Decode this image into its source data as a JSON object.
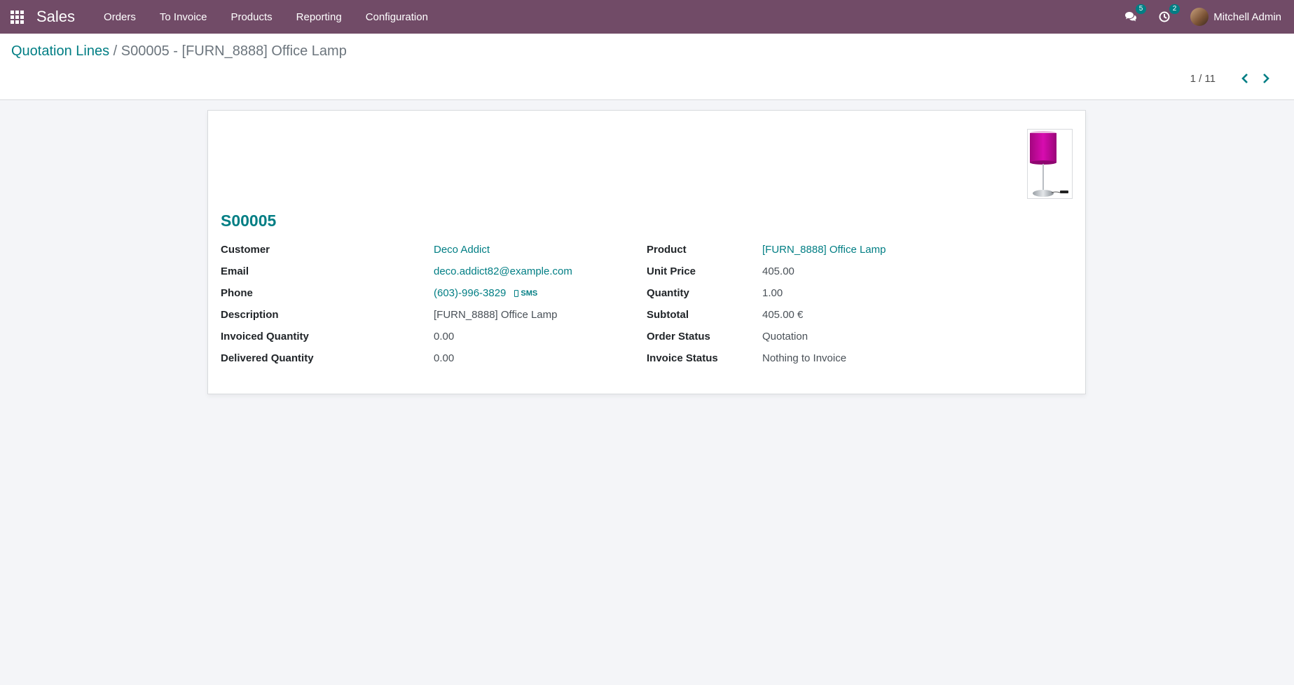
{
  "navbar": {
    "app_name": "Sales",
    "menu": [
      "Orders",
      "To Invoice",
      "Products",
      "Reporting",
      "Configuration"
    ],
    "messages_count": "5",
    "activities_count": "2",
    "user_name": "Mitchell Admin",
    "color": "#714b67"
  },
  "breadcrumb": {
    "parent": "Quotation Lines",
    "separator": "/",
    "current": "S00005 - [FURN_8888] Office Lamp"
  },
  "pager": {
    "value": "1 / 11"
  },
  "form": {
    "title": "S00005",
    "left": [
      {
        "label": "Customer",
        "value": "Deco Addict"
      },
      {
        "label": "Email",
        "value": "deco.addict82@example.com"
      },
      {
        "label": "Phone",
        "value": "(603)-996-3829",
        "sms_label": "SMS"
      },
      {
        "label": "Description",
        "value": "[FURN_8888] Office Lamp"
      },
      {
        "label": "Invoiced Quantity",
        "value": "0.00"
      },
      {
        "label": "Delivered Quantity",
        "value": "0.00"
      }
    ],
    "right": [
      {
        "label": "Product",
        "value": "[FURN_8888] Office Lamp"
      },
      {
        "label": "Unit Price",
        "value": "405.00"
      },
      {
        "label": "Quantity",
        "value": "1.00"
      },
      {
        "label": "Subtotal",
        "value": "405.00 €"
      },
      {
        "label": "Order Status",
        "value": "Quotation"
      },
      {
        "label": "Invoice Status",
        "value": "Nothing to Invoice"
      }
    ]
  },
  "colors": {
    "accent": "#017e84",
    "lamp_shade": "#c2099c"
  }
}
